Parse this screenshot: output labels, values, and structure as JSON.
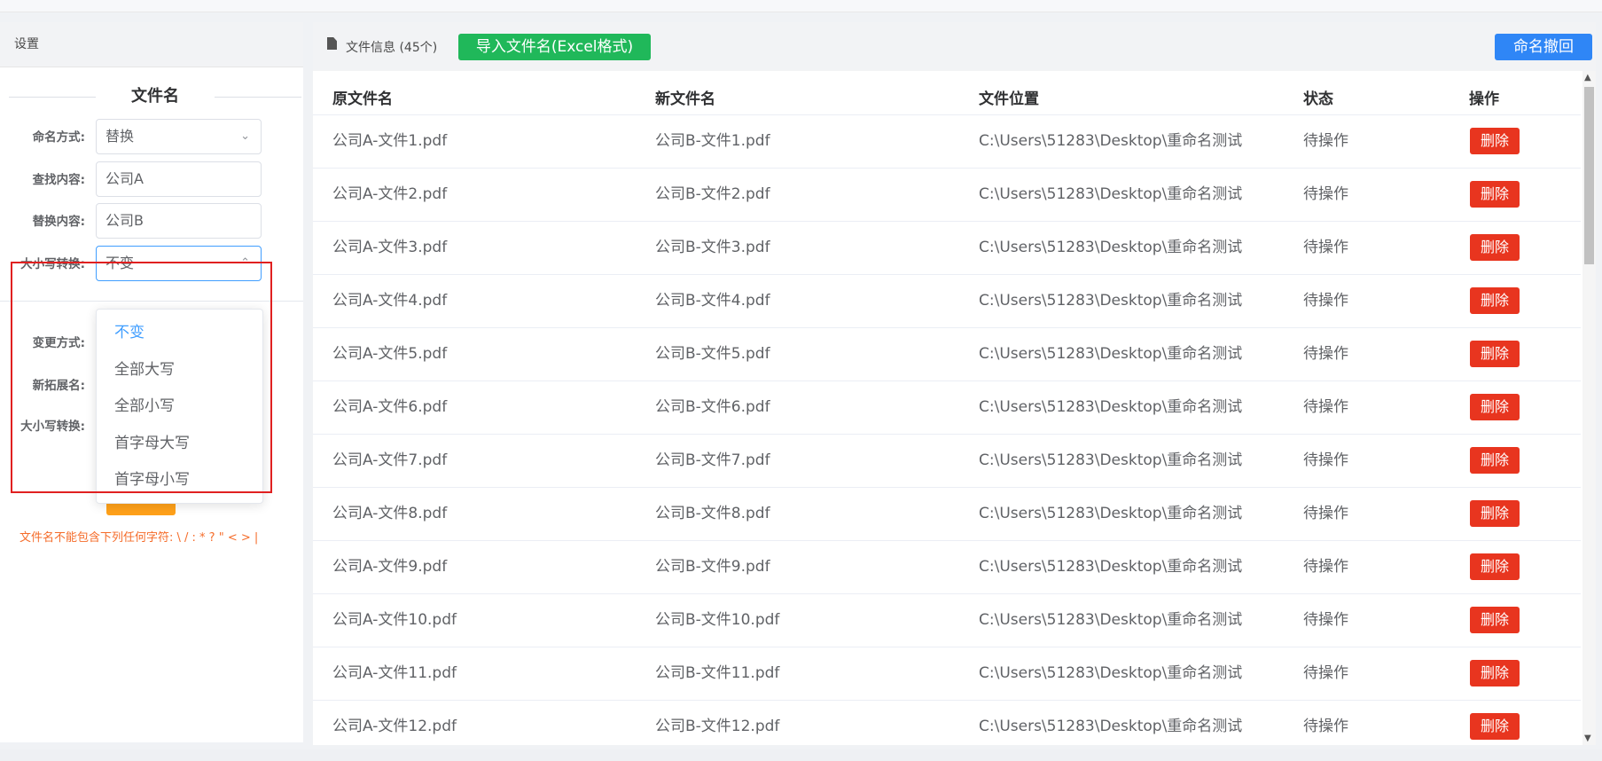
{
  "settings": {
    "title": "设置",
    "section_title": "文件名",
    "naming_mode_label": "命名方式:",
    "naming_mode_value": "替换",
    "find_label": "查找内容:",
    "find_value": "公司A",
    "replace_label": "替换内容:",
    "replace_value": "公司B",
    "case_label": "大小写转换:",
    "case_value": "不变",
    "change_mode_label": "变更方式:",
    "new_ext_label": "新拓展名:",
    "case_label_2": "大小写转换:",
    "warning": "文件名不能包含下列任何字符: \\ / : * ? \" < > |",
    "case_options": [
      "不变",
      "全部大写",
      "全部小写",
      "首字母大写",
      "首字母小写"
    ],
    "case_selected": "不变"
  },
  "file_panel": {
    "info_label": "文件信息 (45个)",
    "import_button": "导入文件名(Excel格式)",
    "undo_button": "命名撤回",
    "columns": [
      "原文件名",
      "新文件名",
      "文件位置",
      "状态",
      "操作"
    ],
    "rows": [
      {
        "orig": "公司A-文件1.pdf",
        "new": "公司B-文件1.pdf",
        "path": "C:\\Users\\51283\\Desktop\\重命名测试",
        "status": "待操作",
        "action": "删除"
      },
      {
        "orig": "公司A-文件2.pdf",
        "new": "公司B-文件2.pdf",
        "path": "C:\\Users\\51283\\Desktop\\重命名测试",
        "status": "待操作",
        "action": "删除"
      },
      {
        "orig": "公司A-文件3.pdf",
        "new": "公司B-文件3.pdf",
        "path": "C:\\Users\\51283\\Desktop\\重命名测试",
        "status": "待操作",
        "action": "删除"
      },
      {
        "orig": "公司A-文件4.pdf",
        "new": "公司B-文件4.pdf",
        "path": "C:\\Users\\51283\\Desktop\\重命名测试",
        "status": "待操作",
        "action": "删除"
      },
      {
        "orig": "公司A-文件5.pdf",
        "new": "公司B-文件5.pdf",
        "path": "C:\\Users\\51283\\Desktop\\重命名测试",
        "status": "待操作",
        "action": "删除"
      },
      {
        "orig": "公司A-文件6.pdf",
        "new": "公司B-文件6.pdf",
        "path": "C:\\Users\\51283\\Desktop\\重命名测试",
        "status": "待操作",
        "action": "删除"
      },
      {
        "orig": "公司A-文件7.pdf",
        "new": "公司B-文件7.pdf",
        "path": "C:\\Users\\51283\\Desktop\\重命名测试",
        "status": "待操作",
        "action": "删除"
      },
      {
        "orig": "公司A-文件8.pdf",
        "new": "公司B-文件8.pdf",
        "path": "C:\\Users\\51283\\Desktop\\重命名测试",
        "status": "待操作",
        "action": "删除"
      },
      {
        "orig": "公司A-文件9.pdf",
        "new": "公司B-文件9.pdf",
        "path": "C:\\Users\\51283\\Desktop\\重命名测试",
        "status": "待操作",
        "action": "删除"
      },
      {
        "orig": "公司A-文件10.pdf",
        "new": "公司B-文件10.pdf",
        "path": "C:\\Users\\51283\\Desktop\\重命名测试",
        "status": "待操作",
        "action": "删除"
      },
      {
        "orig": "公司A-文件11.pdf",
        "new": "公司B-文件11.pdf",
        "path": "C:\\Users\\51283\\Desktop\\重命名测试",
        "status": "待操作",
        "action": "删除"
      },
      {
        "orig": "公司A-文件12.pdf",
        "new": "公司B-文件12.pdf",
        "path": "C:\\Users\\51283\\Desktop\\重命名测试",
        "status": "待操作",
        "action": "删除"
      }
    ]
  },
  "colors": {
    "import_button": "#20b85a",
    "undo_button": "#2f86f6",
    "delete_button": "#e8351f",
    "highlight_box": "#e02020",
    "selected_option": "#409eff"
  }
}
